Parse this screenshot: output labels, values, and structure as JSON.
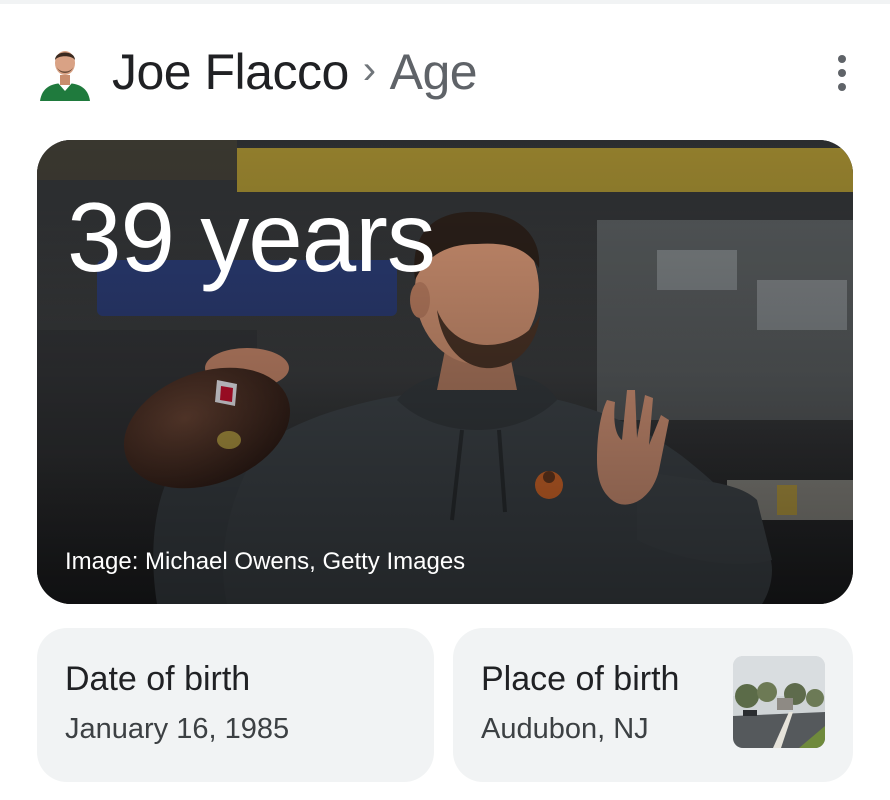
{
  "header": {
    "entity": "Joe Flacco",
    "separator": "›",
    "attribute": "Age",
    "avatar_icon": "person-avatar-icon",
    "more_icon": "more-vert-icon"
  },
  "hero": {
    "value": "39 years",
    "credit": "Image: Michael Owens, Getty Images"
  },
  "cards": {
    "dob": {
      "label": "Date of birth",
      "value": "January 16, 1985"
    },
    "pob": {
      "label": "Place of birth",
      "value": "Audubon, NJ",
      "thumb_icon": "street-photo-icon"
    }
  },
  "colors": {
    "title": "#202124",
    "subtitle": "#5f6368",
    "card_bg": "#f1f3f4",
    "jersey_green": "#1f7a3d"
  }
}
